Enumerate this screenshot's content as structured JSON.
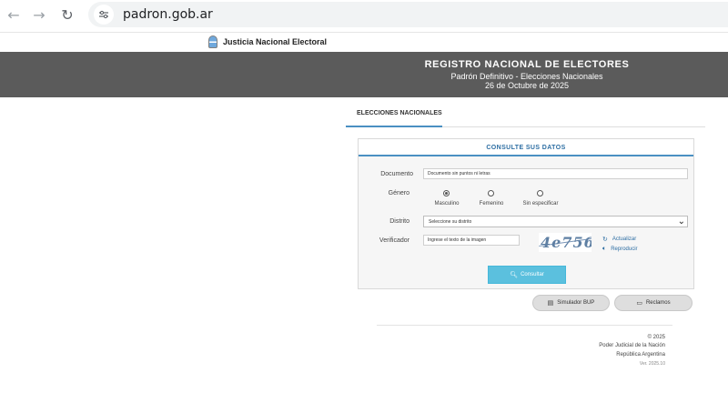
{
  "browser": {
    "url": "padron.gob.ar",
    "icons": [
      "back-arrow-icon",
      "forward-arrow-icon",
      "reload-icon",
      "site-info-icon"
    ]
  },
  "site": {
    "logo_label": "Justicia Nacional Electoral",
    "banner_title": "REGISTRO NACIONAL DE ELECTORES",
    "banner_subtitle": "Padrón Definitivo - Elecciones Nacionales",
    "banner_date": "26 de Octubre de 2025"
  },
  "tabs": [
    {
      "label": "ELECCIONES NACIONALES",
      "active": true
    }
  ],
  "form": {
    "title": "CONSULTE SUS DATOS",
    "documento": {
      "label": "Documento",
      "placeholder": "Documento sin puntos ni letras"
    },
    "genero": {
      "label": "Género",
      "options": [
        {
          "label": "Masculino",
          "checked": true
        },
        {
          "label": "Femenino",
          "checked": false
        },
        {
          "label": "Sin especificar",
          "checked": false
        }
      ]
    },
    "distrito": {
      "label": "Distrito",
      "selected": "Seleccione su distrito"
    },
    "verificador": {
      "label": "Verificador",
      "placeholder": "Ingrese el texto de la imagen",
      "captcha_text": "4e756",
      "actualizar_label": "Actualizar",
      "reproducir_label": "Reproducir"
    },
    "submit_label": "Consultar"
  },
  "actions": {
    "simulador_label": "Simulador BUP",
    "reclamos_label": "Reclamos"
  },
  "footer": {
    "copyright": "© 2025",
    "org1": "Poder Judicial de la Nación",
    "org2": "República Argentina",
    "version": "Ver. 2025.10"
  },
  "colors": {
    "accent": "#4a90c2",
    "button": "#5bc0de",
    "banner": "#5b5b5b"
  }
}
